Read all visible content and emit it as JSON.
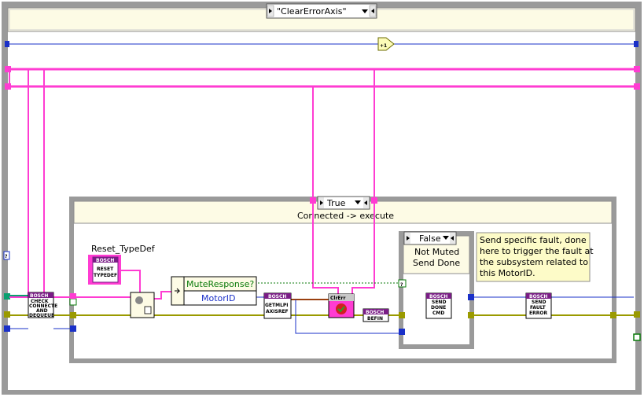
{
  "outer_case": {
    "selector": "\"ClearErrorAxis\""
  },
  "increment_node": {
    "label": "+1"
  },
  "inner_case": {
    "selector": "True",
    "title": "Connected -> execute"
  },
  "reset_typedef": {
    "label": "Reset_TypeDef",
    "icon_lines": [
      "BOSCH",
      "RESET",
      "TYPEDEF"
    ]
  },
  "check_connected": {
    "icon_lines": [
      "BOSCH",
      "CHECK",
      "CONNECTE",
      "AND",
      "DEQUEUE"
    ]
  },
  "bundle": {
    "fields": [
      "MuteResponse?",
      "MotorID"
    ]
  },
  "get_axisref": {
    "icon_lines": [
      "BOSCH",
      "GETMLPI",
      "AXISREF"
    ]
  },
  "clear_error": {
    "label": "ClrErr"
  },
  "bosch_befin": {
    "icon_lines": [
      "BOSCH",
      "BEFIN"
    ]
  },
  "false_case": {
    "selector": "False",
    "title_lines": [
      "Not Muted",
      "Send Done"
    ]
  },
  "send_done": {
    "icon_lines": [
      "BOSCH",
      "SEND",
      "DONE",
      "CMD"
    ]
  },
  "comment": {
    "lines": [
      "Send specific fault, done",
      "here to trigger the fault at",
      "the subsystem related to",
      "this MotorID."
    ]
  },
  "send_fault": {
    "icon_lines": [
      "BOSCH",
      "SEND",
      "FAULT",
      "ERROR"
    ]
  },
  "colors": {
    "frame": "#9a9a9a",
    "frame_bg": "#fdfbe5",
    "pink_wire": "#ff3cd2",
    "blue_wire": "#1a30c8",
    "error_wire": "#9a9a00",
    "bosch": "#7a1d86"
  }
}
